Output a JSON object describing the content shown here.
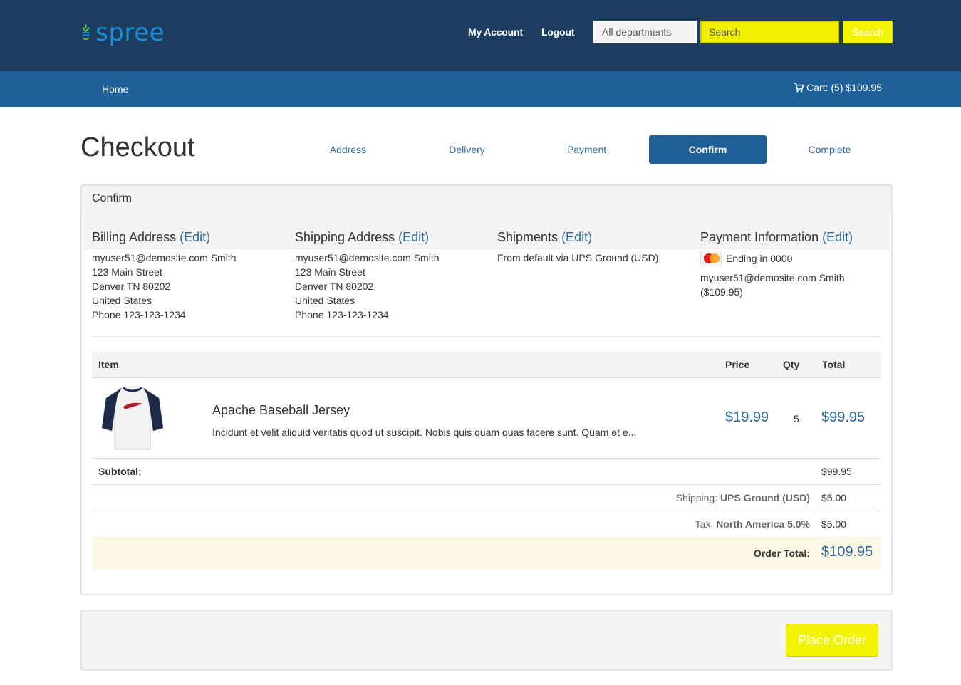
{
  "header": {
    "logo_text": "spree",
    "my_account": "My Account",
    "logout": "Logout",
    "department_select": "All departments",
    "search_placeholder": "Search",
    "search_button": "Search",
    "accent_color": "#f3f200"
  },
  "nav": {
    "home": "Home",
    "cart": "Cart: (5) $109.95"
  },
  "checkout": {
    "title": "Checkout",
    "steps": [
      {
        "label": "Address",
        "active": false
      },
      {
        "label": "Delivery",
        "active": false
      },
      {
        "label": "Payment",
        "active": false
      },
      {
        "label": "Confirm",
        "active": true
      },
      {
        "label": "Complete",
        "active": false
      }
    ]
  },
  "panel": {
    "heading": "Confirm",
    "billing": {
      "title": "Billing Address",
      "edit": "(Edit)",
      "lines": [
        "myuser51@demosite.com Smith",
        "123 Main Street",
        "Denver TN 80202",
        "United States",
        "Phone 123-123-1234"
      ]
    },
    "shipping": {
      "title": "Shipping Address",
      "edit": "(Edit)",
      "lines": [
        "myuser51@demosite.com Smith",
        "123 Main Street",
        "Denver TN 80202",
        "United States",
        "Phone 123-123-1234"
      ]
    },
    "shipments": {
      "title": "Shipments",
      "edit": "(Edit)",
      "line": "From default via UPS Ground (USD)"
    },
    "payment": {
      "title": "Payment Information",
      "edit": "(Edit)",
      "card_ending": "Ending in 0000",
      "card_icon": "mastercard-icon",
      "holder": "myuser51@demosite.com Smith",
      "amount": "($109.95)"
    }
  },
  "table": {
    "headers": {
      "item": "Item",
      "price": "Price",
      "qty": "Qty",
      "total": "Total"
    },
    "items": [
      {
        "name": "Apache Baseball Jersey",
        "description": "Incidunt et velit aliquid veritatis quod ut suscipit. Nobis quis quam quas facere sunt. Quam et e...",
        "price": "$19.99",
        "qty": "5",
        "total": "$99.95"
      }
    ],
    "subtotal_label": "Subtotal:",
    "subtotal_value": "$99.95",
    "shipping_prefix": "Shipping:",
    "shipping_method": "UPS Ground (USD)",
    "shipping_value": "$5.00",
    "tax_prefix": "Tax:",
    "tax_method": "North America 5.0%",
    "tax_value": "$5.00",
    "order_total_label": "Order Total:",
    "order_total_value": "$109.95"
  },
  "actions": {
    "place_order": "Place Order"
  }
}
